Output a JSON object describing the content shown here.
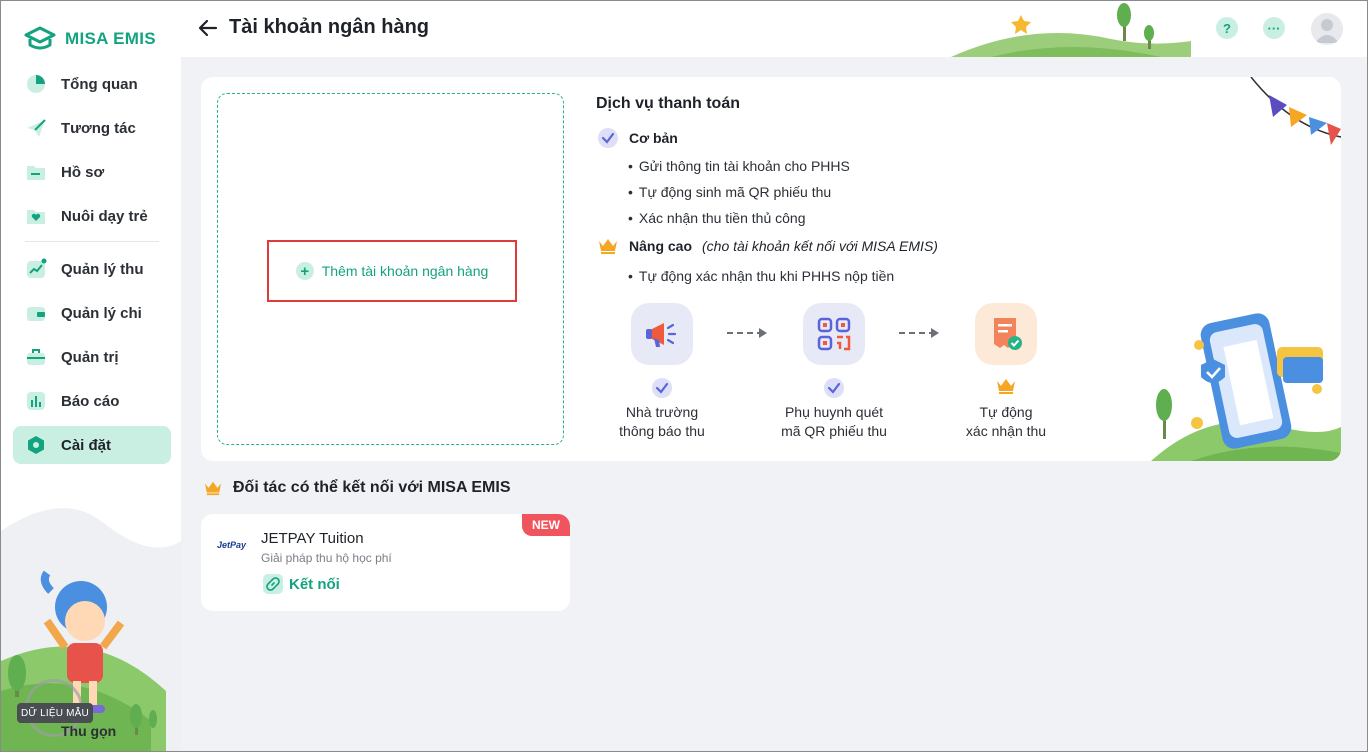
{
  "app": {
    "logo_text": "MISA EMIS",
    "brand_color": "#14a37f",
    "accent_light": "#c9efe3"
  },
  "sidebar": {
    "items": [
      {
        "label": "Tổng quan",
        "icon": "pie-chart-icon"
      },
      {
        "label": "Tương tác",
        "icon": "paper-plane-icon"
      },
      {
        "label": "Hồ sơ",
        "icon": "folder-icon"
      },
      {
        "label": "Nuôi dạy trẻ",
        "icon": "heart-folder-icon"
      },
      {
        "label": "Quản lý thu",
        "icon": "trend-chart-icon"
      },
      {
        "label": "Quản lý chi",
        "icon": "wallet-icon"
      },
      {
        "label": "Quản trị",
        "icon": "briefcase-icon"
      },
      {
        "label": "Báo cáo",
        "icon": "bar-chart-icon"
      },
      {
        "label": "Cài đặt",
        "icon": "settings-hex-icon",
        "active": true
      }
    ],
    "collapse_label": "Thu gọn",
    "sample_badge": "DỮ LIỆU MẪU"
  },
  "header": {
    "title": "Tài khoản ngân hàng",
    "help_icon": "?",
    "more_icon": "···"
  },
  "main": {
    "add_account_label": "Thêm tài khoản ngân hàng",
    "services": {
      "title": "Dịch vụ thanh toán",
      "basic": {
        "label": "Cơ bản",
        "items": [
          "Gửi thông tin tài khoản cho PHHS",
          "Tự động sinh mã QR phiếu thu",
          "Xác nhận thu tiền thủ công"
        ]
      },
      "advanced": {
        "label": "Nâng cao",
        "note": "(cho tài khoản kết nối với MISA EMIS)",
        "items": [
          "Tự động xác nhận thu khi PHHS nộp tiền"
        ]
      },
      "steps": [
        {
          "line1": "Nhà trường",
          "line2": "thông báo thu",
          "icon": "megaphone-icon",
          "mark": "check"
        },
        {
          "line1": "Phụ huynh quét",
          "line2": "mã QR phiếu thu",
          "icon": "qr-code-icon",
          "mark": "check"
        },
        {
          "line1": "Tự động",
          "line2": "xác nhận thu",
          "icon": "receipt-check-icon",
          "mark": "crown"
        }
      ]
    }
  },
  "partners": {
    "heading": "Đối tác có thể kết nối với MISA EMIS",
    "items": [
      {
        "logo_text": "JetPay",
        "name": "JETPAY Tuition",
        "description": "Giải pháp thu hộ học phí",
        "badge": "NEW",
        "action_label": "Kết nối"
      }
    ]
  }
}
